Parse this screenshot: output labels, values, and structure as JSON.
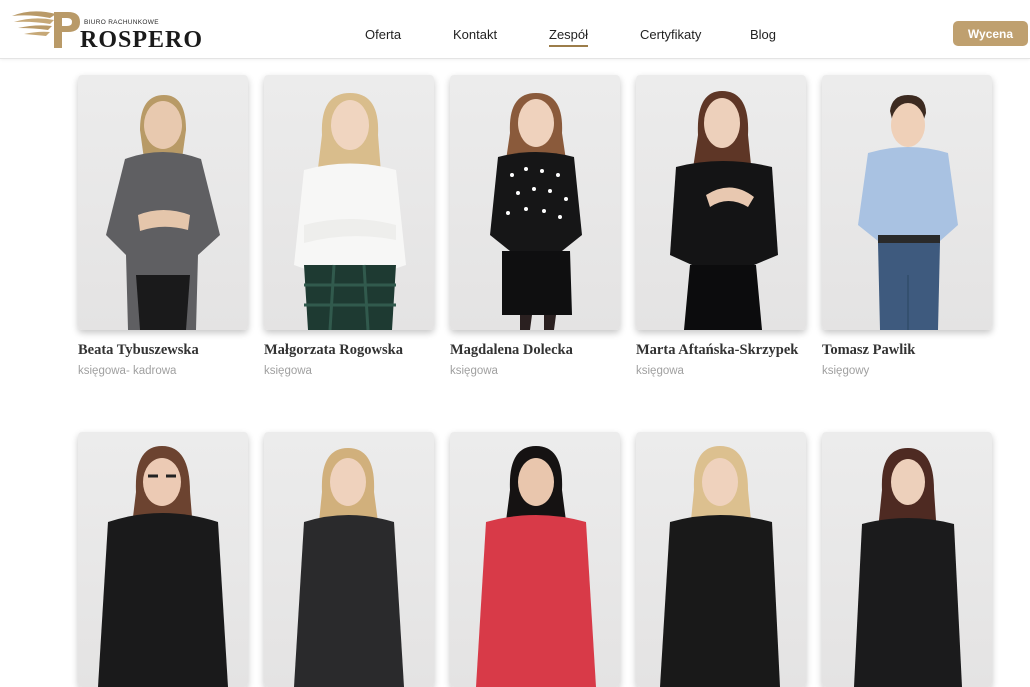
{
  "brand": {
    "small": "BIURO RACHUNKOWE",
    "word": "ROSPERO",
    "gold": "#b99a68"
  },
  "nav": [
    {
      "label": "Oferta"
    },
    {
      "label": "Kontakt"
    },
    {
      "label": "Zespół",
      "active": true
    },
    {
      "label": "Certyfikaty"
    },
    {
      "label": "Blog"
    }
  ],
  "cta": {
    "label": "Wycena",
    "color": "#bfa06f"
  },
  "team": [
    {
      "name": "Beata Tybuszewska",
      "role": "księgowa- kadrowa"
    },
    {
      "name": "Małgorzata Rogowska",
      "role": "księgowa"
    },
    {
      "name": "Magdalena Dolecka",
      "role": "księgowa"
    },
    {
      "name": "Marta Aftańska-Skrzypek",
      "role": "księgowa"
    },
    {
      "name": "Tomasz Pawlik",
      "role": "księgowy"
    }
  ]
}
